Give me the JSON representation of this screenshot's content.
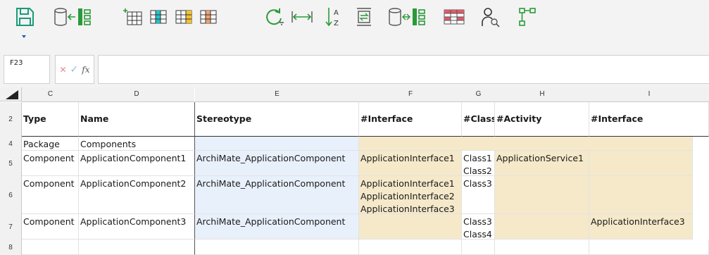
{
  "toolbar": {
    "icons": [
      "save-icon",
      "database-link-icon",
      "insert-table-icon",
      "column-cyan-icon",
      "column-yellow-icon",
      "column-orange-icon",
      "refresh-icon",
      "fit-width-icon",
      "sort-az-icon",
      "export-icon",
      "database-sync-icon",
      "table-view-icon",
      "user-search-icon",
      "hierarchy-icon"
    ],
    "colors": {
      "teal": "#1a9a78",
      "green": "#2a9a3a",
      "gray": "#555555"
    }
  },
  "formula_bar": {
    "cell_ref": "F23",
    "cancel_symbol": "✕",
    "confirm_symbol": "✓",
    "fx_label": "fx",
    "value": ""
  },
  "sheet": {
    "columns": [
      "C",
      "D",
      "E",
      "F",
      "G",
      "H",
      "I"
    ],
    "header_row": {
      "row": "2",
      "cells": [
        "Type",
        "Name",
        "Stereotype",
        "#Interface",
        "#Class",
        "#Activity",
        "#Interface"
      ]
    },
    "rows": [
      {
        "row": "4",
        "type": "Package",
        "name": "Components",
        "stereotype": "",
        "interface": "",
        "class": "",
        "activity": "",
        "interface2": ""
      },
      {
        "row": "5",
        "type": "Component",
        "name": "ApplicationComponent1",
        "stereotype": "ArchiMate_ApplicationComponent",
        "interface": "ApplicationInterface1",
        "class": "Class1\nClass2",
        "activity": "ApplicationService1",
        "interface2": ""
      },
      {
        "row": "6",
        "type": "Component",
        "name": "ApplicationComponent2",
        "stereotype": "ArchiMate_ApplicationComponent",
        "interface": "ApplicationInterface1\nApplicationInterface2\nApplicationInterface3",
        "class": "Class3",
        "activity": "",
        "interface2": ""
      },
      {
        "row": "7",
        "type": "Component",
        "name": "ApplicationComponent3",
        "stereotype": "ArchiMate_ApplicationComponent",
        "interface": "",
        "class": "Class3\nClass4",
        "activity": "",
        "interface2": "ApplicationInterface3"
      },
      {
        "row": "8",
        "type": "",
        "name": "",
        "stereotype": "",
        "interface": "",
        "class": "",
        "activity": "",
        "interface2": ""
      }
    ]
  }
}
